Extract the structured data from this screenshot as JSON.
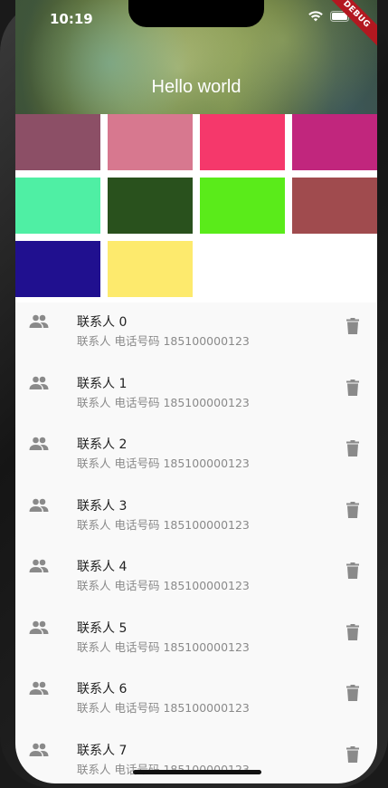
{
  "status_bar": {
    "time": "10:19"
  },
  "debug_banner": "DEBUG",
  "header": {
    "title": "Hello world"
  },
  "tiles": [
    "#8c4f66",
    "#d7788f",
    "#f5386b",
    "#c1267d",
    "#4fefa4",
    "#29511d",
    "#5aeb1a",
    "#a04b4e",
    "#20108f",
    "#fdea6d"
  ],
  "contacts": [
    {
      "name": "联系人 0",
      "phone": "联系人 电话号码 185100000123"
    },
    {
      "name": "联系人 1",
      "phone": "联系人 电话号码 185100000123"
    },
    {
      "name": "联系人 2",
      "phone": "联系人 电话号码 185100000123"
    },
    {
      "name": "联系人 3",
      "phone": "联系人 电话号码 185100000123"
    },
    {
      "name": "联系人 4",
      "phone": "联系人 电话号码 185100000123"
    },
    {
      "name": "联系人 5",
      "phone": "联系人 电话号码 185100000123"
    },
    {
      "name": "联系人 6",
      "phone": "联系人 电话号码 185100000123"
    },
    {
      "name": "联系人 7",
      "phone": "联系人 电话号码 185100000123"
    }
  ]
}
